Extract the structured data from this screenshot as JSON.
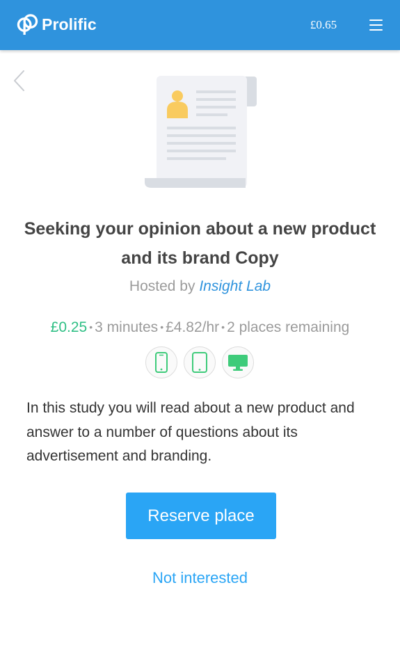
{
  "header": {
    "app_name": "Prolific",
    "balance": "£0.65",
    "logo_icon": "prolific-logo-icon",
    "menu_icon": "hamburger-menu-icon",
    "background_color": "#2f93dd"
  },
  "navigation": {
    "back_icon": "chevron-left-icon"
  },
  "study": {
    "illustration_icon": "document-scroll-illustration",
    "title": "Seeking your opinion about a new product and its brand Copy",
    "hosted_by_prefix": "Hosted by",
    "researcher": "Insight Lab",
    "reward": "£0.25",
    "duration": "3 minutes",
    "hourly_rate": "£4.82/hr",
    "places_remaining": "2 places remaining",
    "separator": "•",
    "devices": [
      {
        "name": "mobile",
        "icon": "phone-icon"
      },
      {
        "name": "tablet",
        "icon": "tablet-icon"
      },
      {
        "name": "desktop",
        "icon": "desktop-icon"
      }
    ],
    "description": "In this study you will read about a new product and answer to a number of questions about its advertisement and branding."
  },
  "actions": {
    "reserve_label": "Reserve place",
    "not_interested_label": "Not interested"
  },
  "colors": {
    "accent": "#2aa5f5",
    "reward_green": "#2fbf85",
    "device_green": "#3ecb7a",
    "muted_text": "#9b9b9b"
  }
}
